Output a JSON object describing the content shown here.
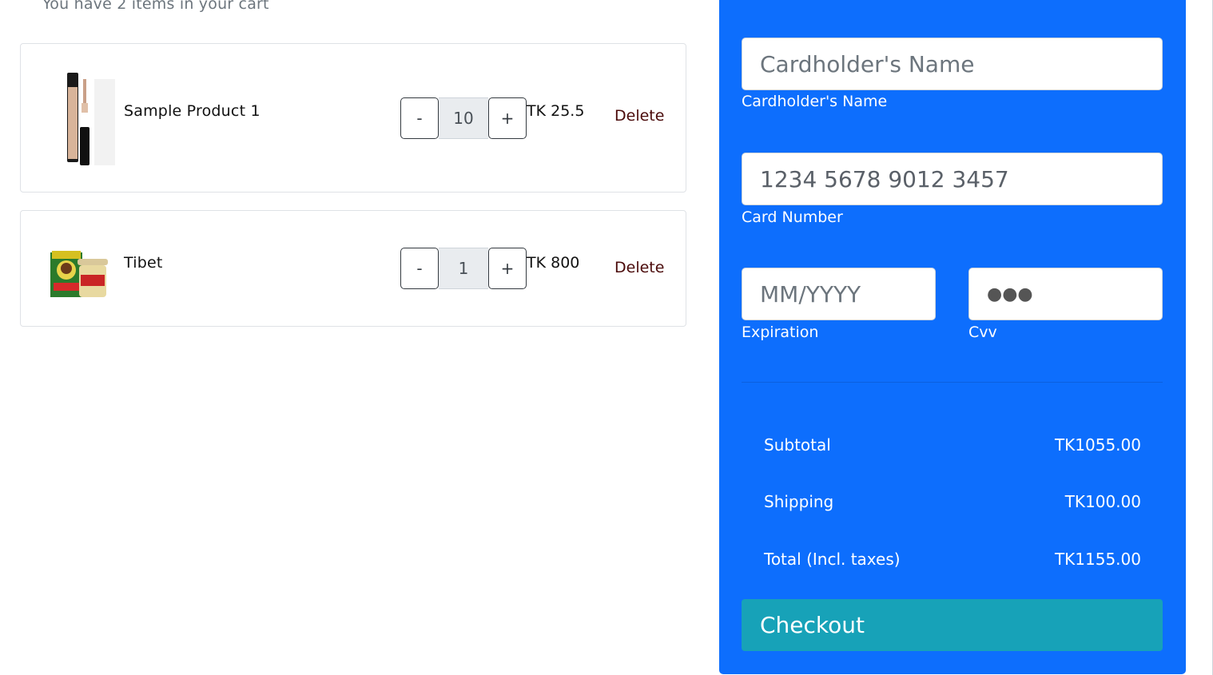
{
  "cart": {
    "subtitle": "You have 2 items in your cart",
    "items": [
      {
        "name": "Sample Product 1",
        "quantity": "10",
        "price": "TK 25.5",
        "delete_label": "Delete",
        "minus_label": "-",
        "plus_label": "+"
      },
      {
        "name": "Tibet",
        "quantity": "1",
        "price": "TK 800",
        "delete_label": "Delete",
        "minus_label": "-",
        "plus_label": "+"
      }
    ]
  },
  "payment": {
    "cardholder_placeholder": "Cardholder's Name",
    "cardholder_label": "Cardholder's Name",
    "card_number_value": "1234 5678 9012 3457",
    "card_number_label": "Card Number",
    "expiration_placeholder": "MM/YYYY",
    "expiration_label": "Expiration",
    "cvv_value": "●●●",
    "cvv_label": "Cvv"
  },
  "summary": {
    "subtotal_label": "Subtotal",
    "subtotal_value": "TK1055.00",
    "shipping_label": "Shipping",
    "shipping_value": "TK100.00",
    "total_label": "Total (Incl. taxes)",
    "total_value": "TK1155.00"
  },
  "checkout_label": "Checkout",
  "colors": {
    "panel": "#0d6efd",
    "checkout": "#17a2b8"
  }
}
